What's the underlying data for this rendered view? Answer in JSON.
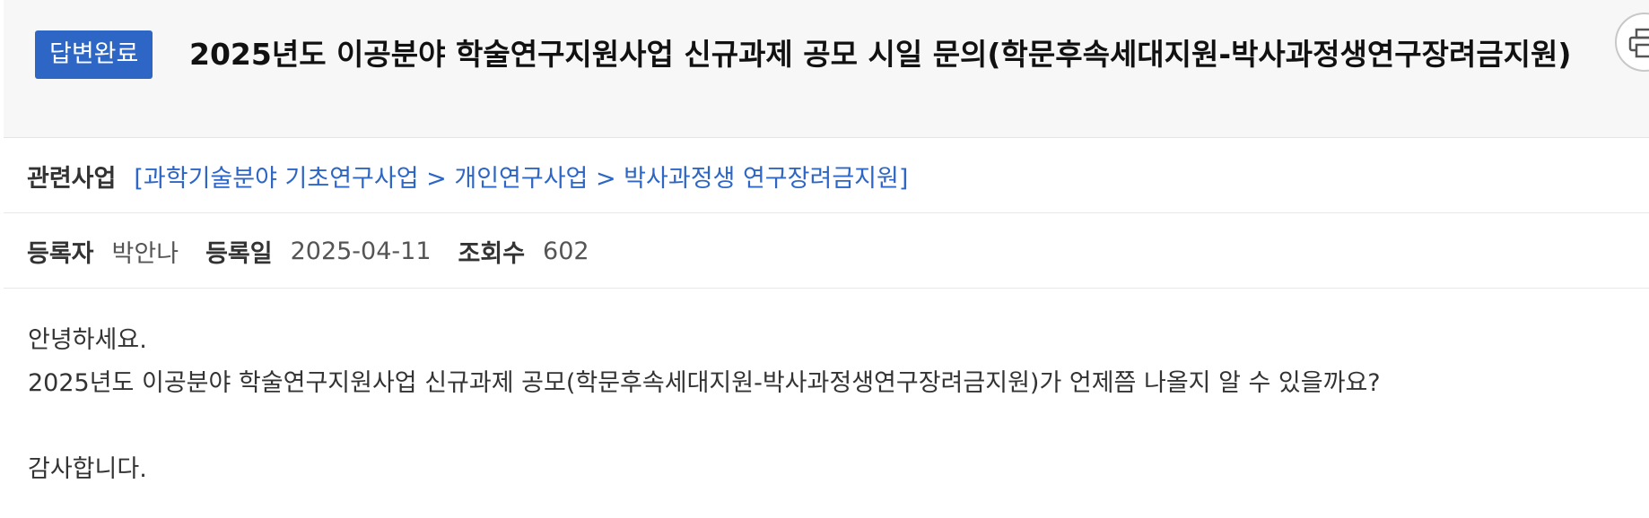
{
  "header": {
    "status_badge": "답변완료",
    "title": "2025년도 이공분야 학술연구지원사업 신규과제 공모 시일 문의(학문후속세대지원-박사과정생연구장려금지원)"
  },
  "business": {
    "label": "관련사업",
    "link": "[과학기술분야 기초연구사업 > 개인연구사업 > 박사과정생 연구장려금지원]"
  },
  "meta": {
    "author_label": "등록자",
    "author": "박안나",
    "date_label": "등록일",
    "date": "2025-04-11",
    "views_label": "조회수",
    "views": "602"
  },
  "body": {
    "line1": "안녕하세요.",
    "line2": "2025년도 이공분야 학술연구지원사업 신규과제 공모(학문후속세대지원-박사과정생연구장려금지원)가 언제쯤 나올지 알 수 있을까요?",
    "line3": "감사합니다."
  },
  "icons": {
    "print": "print-icon"
  },
  "colors": {
    "accent": "#2d66c4",
    "header_bg": "#f7f7f7"
  }
}
